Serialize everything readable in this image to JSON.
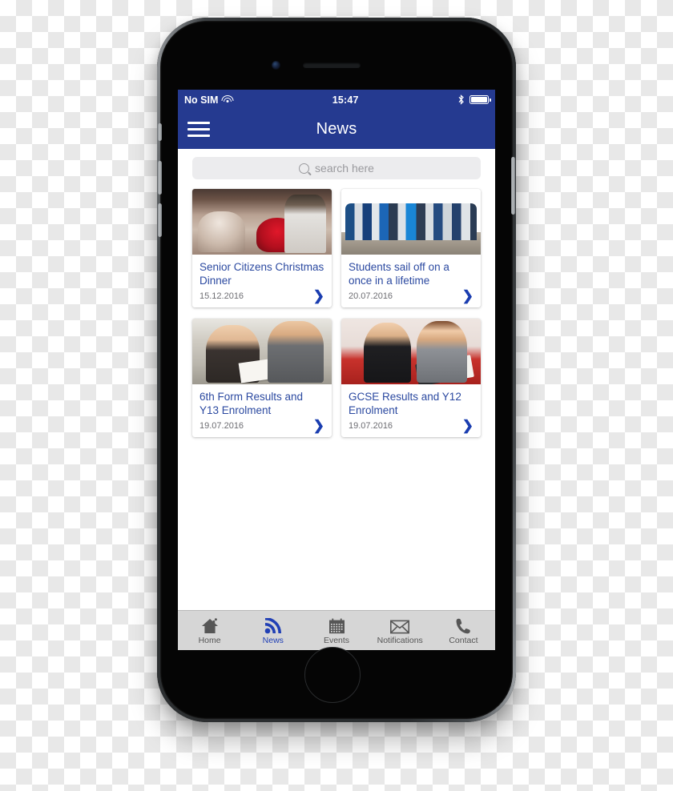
{
  "device": {
    "name": "iphone-mockup",
    "status_bar": {
      "carrier": "No SIM",
      "wifi_icon": "wifi-icon",
      "time": "15:47",
      "bluetooth_icon": "bluetooth-icon",
      "battery_icon": "battery-full-icon"
    }
  },
  "nav": {
    "menu_icon": "hamburger-menu-icon",
    "title": "News"
  },
  "search": {
    "icon": "search-icon",
    "placeholder": "search here",
    "value": ""
  },
  "news": {
    "cards": [
      {
        "title": "Senior Citizens Christmas Dinner",
        "date": "15.12.2016",
        "photo": "senior-citizens-christmas-dinner-photo",
        "chevron": "❯"
      },
      {
        "title": "Students sail off on a once in a lifetime",
        "date": "20.07.2016",
        "photo": "students-sailing-group-photo",
        "chevron": "❯"
      },
      {
        "title": "6th Form Results and Y13 Enrolment",
        "date": "19.07.2016",
        "photo": "sixth-form-results-photo",
        "chevron": "❯"
      },
      {
        "title": "GCSE Results and Y12 Enrolment",
        "date": "19.07.2016",
        "photo": "gcse-results-photo",
        "chevron": "❯"
      }
    ]
  },
  "tabbar": {
    "tabs": [
      {
        "label": "Home",
        "icon": "home-icon",
        "active": false
      },
      {
        "label": "News",
        "icon": "rss-icon",
        "active": true
      },
      {
        "label": "Events",
        "icon": "calendar-icon",
        "active": false
      },
      {
        "label": "Notifications",
        "icon": "envelope-icon",
        "active": false
      },
      {
        "label": "Contact",
        "icon": "phone-icon",
        "active": false
      }
    ]
  },
  "colors": {
    "brand_navy": "#253a90",
    "title_blue": "#2b49a0",
    "active_tab": "#2140b5",
    "inactive_tab": "#565656",
    "tabbar_bg": "#d6d6d6",
    "search_bg": "#ececee",
    "date_gray": "#6d6d72"
  }
}
